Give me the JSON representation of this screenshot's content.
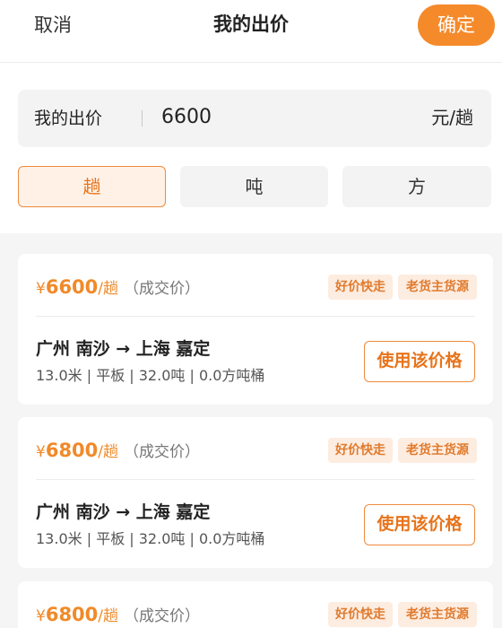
{
  "header": {
    "cancel_label": "取消",
    "title": "我的出价",
    "confirm_label": "确定"
  },
  "bid": {
    "label": "我的出价",
    "value": "6600",
    "unit": "元/趟"
  },
  "unit_tabs": [
    {
      "label": "趟",
      "active": true
    },
    {
      "label": "吨",
      "active": false
    },
    {
      "label": "方",
      "active": false
    }
  ],
  "listings": [
    {
      "currency": "¥",
      "price": "6600",
      "per": "/趟",
      "deal_note": "（成交价）",
      "tags": [
        "好价快走",
        "老货主货源"
      ],
      "route": "广州 南沙 → 上海 嘉定",
      "specs": "13.0米 | 平板 | 32.0吨 | 0.0方吨桶",
      "action_label": "使用该价格"
    },
    {
      "currency": "¥",
      "price": "6800",
      "per": "/趟",
      "deal_note": "（成交价）",
      "tags": [
        "好价快走",
        "老货主货源"
      ],
      "route": "广州 南沙 → 上海 嘉定",
      "specs": "13.0米 | 平板 | 32.0吨 | 0.0方吨桶",
      "action_label": "使用该价格"
    },
    {
      "currency": "¥",
      "price": "6800",
      "per": "/趟",
      "deal_note": "（成交价）",
      "tags": [
        "好价快走",
        "老货主货源"
      ]
    }
  ],
  "colors": {
    "accent": "#f58a2b",
    "accent_text": "#e8731a",
    "tag_bg": "#fdece0",
    "page_bg": "#f5f5f5"
  }
}
